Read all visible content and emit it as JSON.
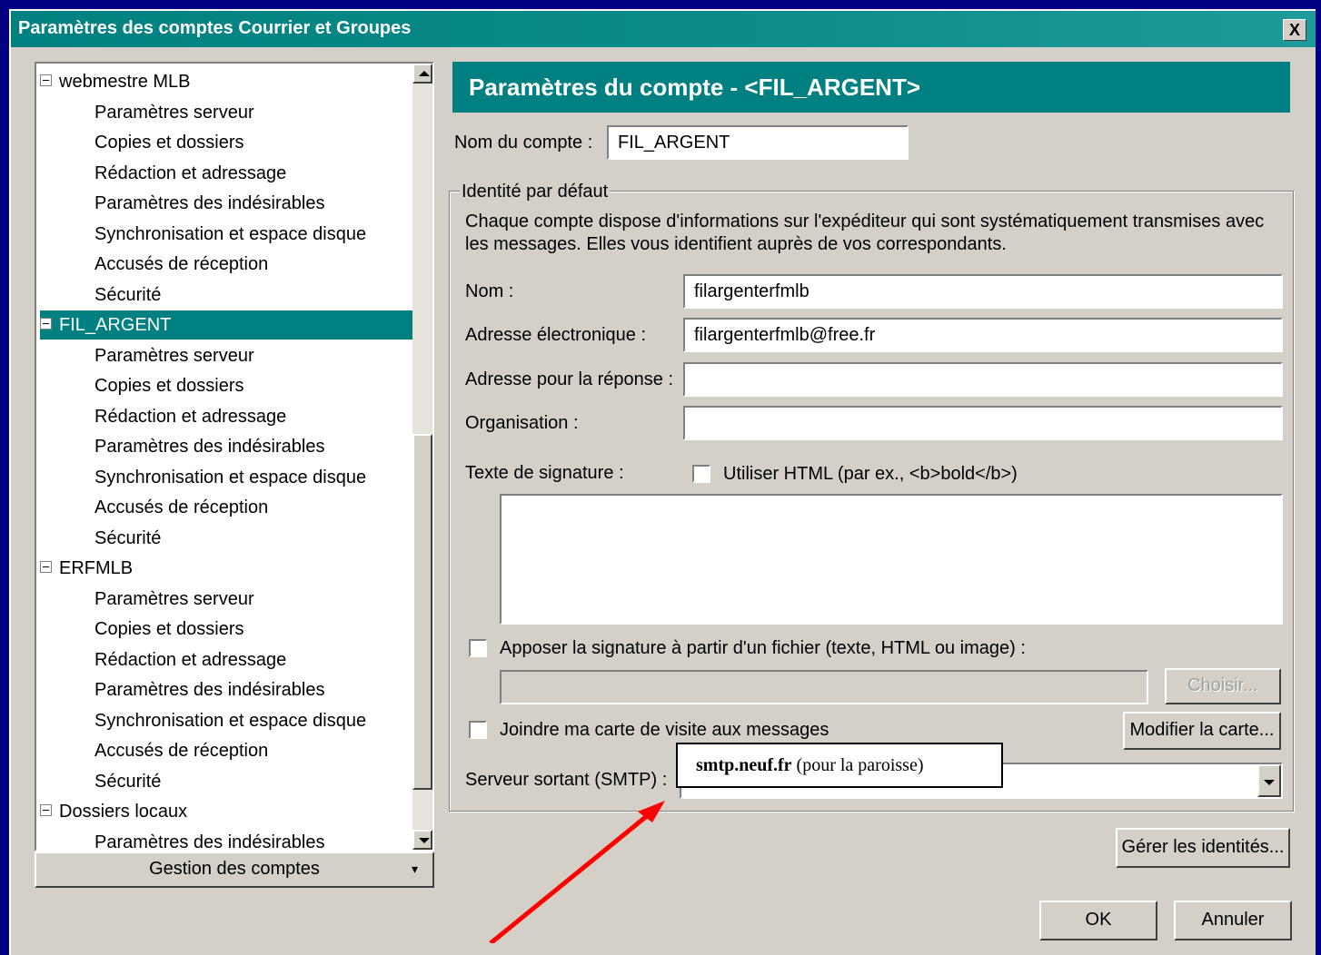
{
  "window": {
    "title": "Paramètres des comptes Courrier et Groupes",
    "close_label": "X"
  },
  "tree": {
    "accounts": [
      {
        "name": "webmestre MLB",
        "children": [
          "Paramètres serveur",
          "Copies et dossiers",
          "Rédaction et adressage",
          "Paramètres des indésirables",
          "Synchronisation et espace disque",
          "Accusés de réception",
          "Sécurité"
        ]
      },
      {
        "name": "FIL_ARGENT",
        "selected": true,
        "children": [
          "Paramètres serveur",
          "Copies et dossiers",
          "Rédaction et adressage",
          "Paramètres des indésirables",
          "Synchronisation et espace disque",
          "Accusés de réception",
          "Sécurité"
        ]
      },
      {
        "name": "ERFMLB",
        "children": [
          "Paramètres serveur",
          "Copies et dossiers",
          "Rédaction et adressage",
          "Paramètres des indésirables",
          "Synchronisation et espace disque",
          "Accusés de réception",
          "Sécurité"
        ]
      },
      {
        "name": "Dossiers locaux",
        "children": [
          "Paramètres des indésirables"
        ]
      }
    ],
    "manage_button": "Gestion des comptes",
    "manage_dropdown": "▾"
  },
  "panel": {
    "header": "Paramètres du compte - <FIL_ARGENT>",
    "account_name_label": "Nom du compte :",
    "account_name_value": "FIL_ARGENT",
    "identity_legend": "Identité par défaut",
    "identity_desc": "Chaque compte dispose d'informations sur l'expéditeur qui sont systématiquement transmises avec les messages. Elles vous identifient auprès de vos correspondants.",
    "name_label": "Nom :",
    "name_value": "filargenterfmlb",
    "email_label": "Adresse électronique :",
    "email_value": "filargenterfmlb@free.fr",
    "reply_label": "Adresse pour la réponse :",
    "reply_value": "",
    "org_label": "Organisation :",
    "org_value": "",
    "signature_label": "Texte de signature :",
    "use_html_label": "Utiliser HTML (par ex., <b>bold</b>)",
    "attach_sig_label": "Apposer la signature à partir d'un fichier (texte, HTML ou image) :",
    "choose_button": "Choisir...",
    "vcard_label": "Joindre ma carte de visite aux messages",
    "modify_card_button": "Modifier la carte...",
    "smtp_label": "Serveur sortant (SMTP) :",
    "manage_identities_button": "Gérer les identités...",
    "ok_button": "OK",
    "cancel_button": "Annuler"
  },
  "callout": {
    "bold": "smtp.neuf.fr",
    "rest": " (pour la paroisse)"
  },
  "colors": {
    "accent": "#008080",
    "arrow": "#ff0000",
    "background": "#000080"
  }
}
